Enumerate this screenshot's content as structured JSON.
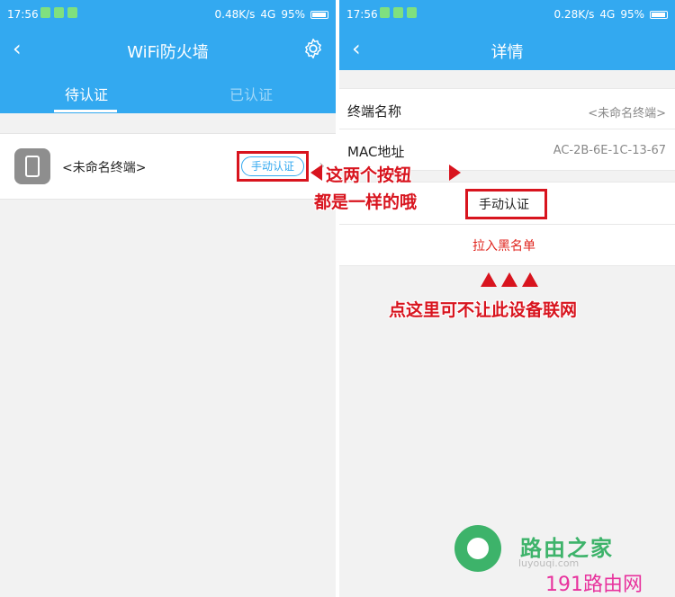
{
  "left": {
    "status": {
      "time": "17:56",
      "speed": "0.48K/s",
      "network": "4G",
      "battery": "95%"
    },
    "nav": {
      "back": "‹",
      "title": "WiFi防火墙"
    },
    "tabs": [
      "待认证",
      "已认证"
    ],
    "device": {
      "name": "<未命名终端>",
      "manual_auth_label": "手动认证",
      "chevron": "›"
    }
  },
  "right": {
    "status": {
      "time": "17:56",
      "speed": "0.28K/s",
      "network": "4G",
      "battery": "95%"
    },
    "nav": {
      "back": "‹",
      "title": "详情"
    },
    "rows": [
      {
        "label": "终端名称",
        "value": "<未命名终端>"
      },
      {
        "label": "MAC地址",
        "value": "AC-2B-6E-1C-13-67"
      }
    ],
    "actions": {
      "manual_auth": "手动认证",
      "blacklist": "拉入黑名单"
    }
  },
  "annotations": {
    "line1": "这两个按钮",
    "line2": "都是一样的哦",
    "line3": "点这里可不让此设备联网"
  },
  "watermark": {
    "brand_cn": "路由之家",
    "url": "luyouqi.com",
    "site": "191路由网"
  },
  "colors": {
    "primary": "#33a9f0",
    "annotation_red": "#d8141e",
    "blacklist_red": "#e0261f"
  }
}
